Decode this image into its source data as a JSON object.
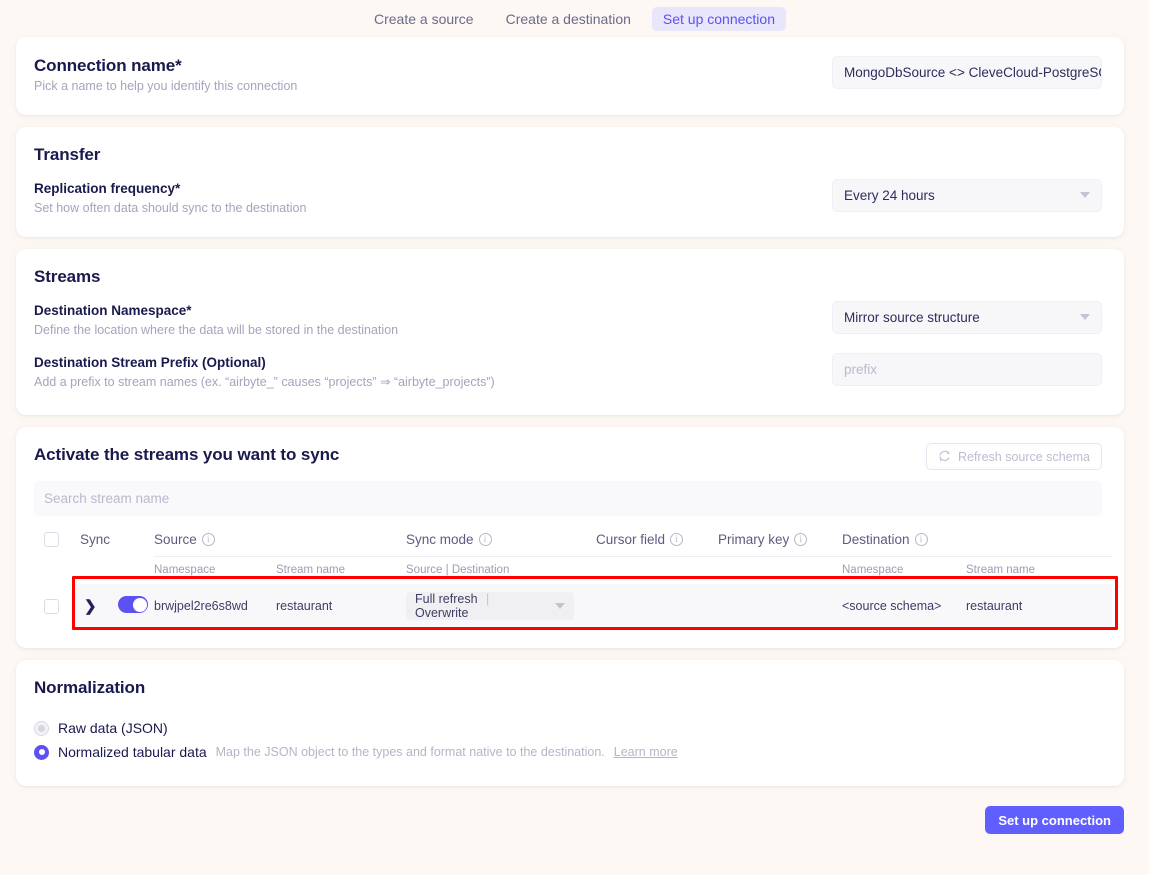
{
  "stepnav": {
    "steps": [
      {
        "label": "Create a source",
        "active": false
      },
      {
        "label": "Create a destination",
        "active": false
      },
      {
        "label": "Set up connection",
        "active": true
      }
    ]
  },
  "connection": {
    "title": "Connection name*",
    "description": "Pick a name to help you identify this connection",
    "value": "MongoDbSource <> CleveCloud-PostgreSQL"
  },
  "transfer": {
    "title": "Transfer",
    "frequency_label": "Replication frequency*",
    "frequency_desc": "Set how often data should sync to the destination",
    "frequency_value": "Every 24 hours"
  },
  "streams": {
    "title": "Streams",
    "namespace_label": "Destination Namespace*",
    "namespace_desc": "Define the location where the data will be stored in the destination",
    "namespace_value": "Mirror source structure",
    "prefix_label": "Destination Stream Prefix (Optional)",
    "prefix_desc": "Add a prefix to stream names (ex. “airbyte_” causes “projects” ⇒ “airbyte_projects”)",
    "prefix_placeholder": "prefix"
  },
  "activate": {
    "title": "Activate the streams you want to sync",
    "refresh_label": "Refresh source schema",
    "refresh_icon": "refresh-icon",
    "search_placeholder": "Search stream name",
    "columns": {
      "sync": "Sync",
      "source": "Source",
      "sync_mode": "Sync mode",
      "cursor_field": "Cursor field",
      "primary_key": "Primary key",
      "destination": "Destination"
    },
    "subcolumns": {
      "source_namespace": "Namespace",
      "source_stream": "Stream name",
      "sync_mode": "Source | Destination",
      "dest_namespace": "Namespace",
      "dest_stream": "Stream name"
    },
    "rows": [
      {
        "expand_icon": "chevron-right-icon",
        "enabled": true,
        "source_namespace": "brwjpel2re6s8wd",
        "source_stream": "restaurant",
        "sync_mode_source": "Full refresh",
        "sync_mode_separator": "|",
        "sync_mode_destination": "Overwrite",
        "cursor_field": "",
        "primary_key": "",
        "dest_namespace": "<source schema>",
        "dest_stream": "restaurant"
      }
    ]
  },
  "normalization": {
    "title": "Normalization",
    "options": [
      {
        "label": "Raw data (JSON)",
        "selected": false,
        "help": "",
        "link": ""
      },
      {
        "label": "Normalized tabular data",
        "selected": true,
        "help": "Map the JSON object to the types and format native to the destination.",
        "link": "Learn more"
      }
    ]
  },
  "footer": {
    "submit_label": "Set up connection"
  },
  "colors": {
    "accent": "#615eff",
    "accent_soft": "#e8e6fb",
    "background": "#fdf8f3",
    "annotation": "#ff0000"
  }
}
